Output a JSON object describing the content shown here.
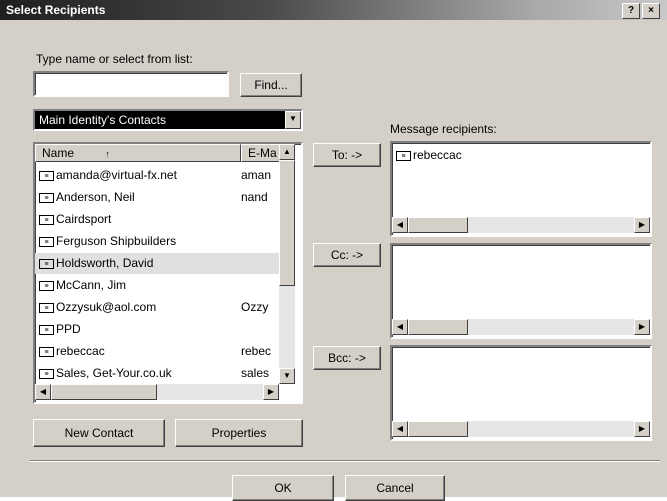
{
  "window": {
    "title": "Select Recipients",
    "help_label": "?",
    "close_label": "×"
  },
  "search": {
    "label": "Type name or select from list:",
    "value": "",
    "find_label": "Find..."
  },
  "address_book": {
    "selected": "Main Identity's Contacts"
  },
  "contacts": {
    "columns": [
      "Name",
      "E-Ma"
    ],
    "rows": [
      {
        "name": "amanda@virtual-fx.net",
        "email": "aman",
        "selected": false
      },
      {
        "name": "Anderson, Neil",
        "email": "nand",
        "selected": false
      },
      {
        "name": "Cairdsport",
        "email": "",
        "selected": false
      },
      {
        "name": "Ferguson Shipbuilders",
        "email": "",
        "selected": false
      },
      {
        "name": "Holdsworth, David",
        "email": "",
        "selected": true
      },
      {
        "name": "McCann, Jim",
        "email": "",
        "selected": false
      },
      {
        "name": "Ozzysuk@aol.com",
        "email": "Ozzy",
        "selected": false
      },
      {
        "name": "PPD",
        "email": "",
        "selected": false
      },
      {
        "name": "rebeccac",
        "email": "rebec",
        "selected": false
      },
      {
        "name": "Sales, Get-Your.co.uk",
        "email": "sales",
        "selected": false
      }
    ]
  },
  "recipients": {
    "label": "Message recipients:",
    "to_label": "To: ->",
    "cc_label": "Cc: ->",
    "bcc_label": "Bcc: ->",
    "to_items": [
      "rebeccac"
    ],
    "cc_items": [],
    "bcc_items": []
  },
  "actions": {
    "new_contact": "New Contact",
    "properties": "Properties",
    "ok": "OK",
    "cancel": "Cancel"
  },
  "icons": {
    "contact": "contact-card-icon",
    "sort": "sort-arrow-icon",
    "dropdown": "chevron-down-icon"
  }
}
